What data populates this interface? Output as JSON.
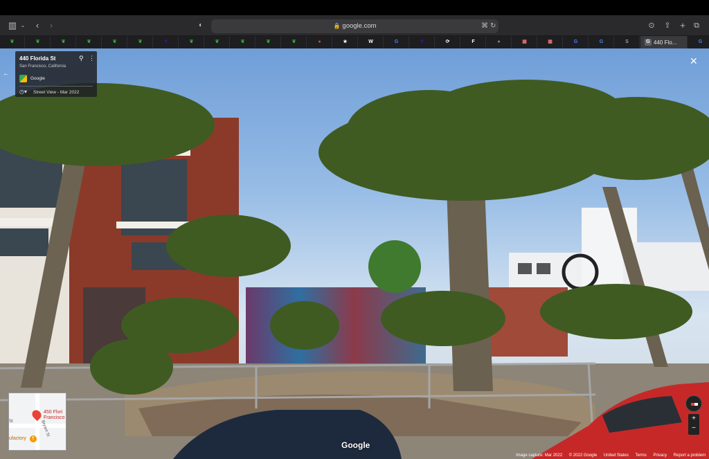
{
  "browser": {
    "url": "google.com",
    "tabs": [
      {
        "icon": "leaf-icon",
        "color": "#3aa83a"
      },
      {
        "icon": "leaf-icon",
        "color": "#3aa83a"
      },
      {
        "icon": "leaf-icon",
        "color": "#3aa83a"
      },
      {
        "icon": "leaf-icon",
        "color": "#3aa83a"
      },
      {
        "icon": "leaf-icon",
        "color": "#3aa83a"
      },
      {
        "icon": "leaf-icon",
        "color": "#3aa83a"
      },
      {
        "icon": "yahoo-icon",
        "color": "#6001d2"
      },
      {
        "icon": "leaf-icon",
        "color": "#3aa83a"
      },
      {
        "icon": "leaf-icon",
        "color": "#3aa83a"
      },
      {
        "icon": "leaf-icon",
        "color": "#3aa83a"
      },
      {
        "icon": "leaf-icon",
        "color": "#3aa83a"
      },
      {
        "icon": "leaf-icon",
        "color": "#3aa83a"
      },
      {
        "icon": "reddit-icon",
        "color": "#ff4500"
      },
      {
        "icon": "star-icon",
        "color": "#ffffff"
      },
      {
        "icon": "wikipedia-icon",
        "color": "#ffffff"
      },
      {
        "icon": "google-icon",
        "color": "#4285f4"
      },
      {
        "icon": "yahoo-icon",
        "color": "#6001d2"
      },
      {
        "icon": "sync-icon",
        "color": "#ffffff"
      },
      {
        "icon": "f-icon",
        "color": "#ffffff"
      },
      {
        "icon": "dot-icon",
        "color": "#888888"
      },
      {
        "icon": "grid-icon",
        "color": "#e57373"
      },
      {
        "icon": "grid-icon",
        "color": "#e57373"
      },
      {
        "icon": "google-icon",
        "color": "#4285f4"
      },
      {
        "icon": "google-icon",
        "color": "#4285f4"
      },
      {
        "icon": "s-icon",
        "color": "#9e9e9e"
      }
    ],
    "active_tab_label": "440 Flo...",
    "last_tab_icon": "google-icon"
  },
  "streetview": {
    "address": "440 Florida St",
    "city": "San Francisco, California",
    "provider": "Google",
    "capture_label": "Street View - Mar 2022",
    "watermark": "Google",
    "close": "✕",
    "footer": [
      "Image capture: Mar 2022",
      "© 2022 Google",
      "United States",
      "Terms",
      "Privacy",
      "Report a problem"
    ]
  },
  "minimap": {
    "place": "450 Flori\nFrancisco",
    "street_left": "St",
    "street_bryant": "Bryant St",
    "business": "ufactory"
  },
  "colors": {
    "sky_top": "#6f9ed8",
    "palm_dark": "#3f5b22",
    "brick": "#8b3a2a"
  }
}
